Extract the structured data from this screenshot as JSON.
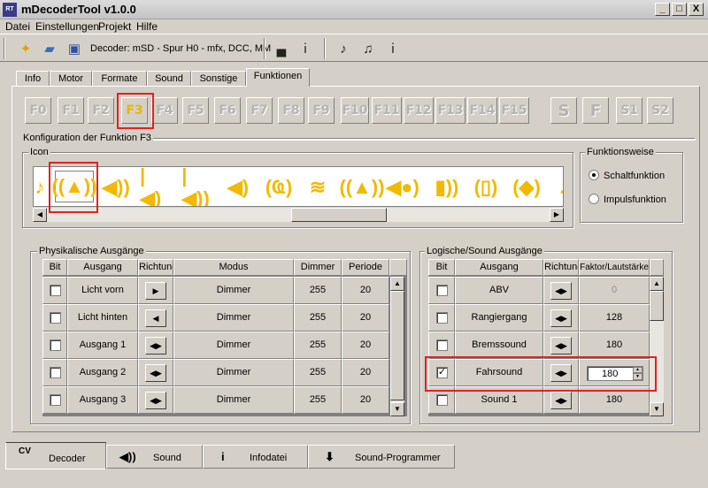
{
  "window": {
    "title": "mDecoderTool v1.0.0",
    "icon_label": "RT",
    "min": "_",
    "max": "□",
    "close": "X"
  },
  "menu": [
    "Datei",
    "Einstellungen",
    "Projekt",
    "Hilfe"
  ],
  "toolbar": {
    "decoder_info": "Decoder: mSD - Spur H0 - mfx, DCC, MM"
  },
  "tabs": [
    "Info",
    "Motor",
    "Formate",
    "Sound",
    "Sonstige",
    "Funktionen"
  ],
  "active_tab": "Funktionen",
  "function_buttons": [
    "F0",
    "F1",
    "F2",
    "F3",
    "F4",
    "F5",
    "F6",
    "F7",
    "F8",
    "F9",
    "F10",
    "F11",
    "F12",
    "F13",
    "F14",
    "F15"
  ],
  "special_buttons": [
    "S",
    "F",
    "S1",
    "S2"
  ],
  "selected_function": "F3",
  "config": {
    "title": "Konfiguration der Funktion F3",
    "icon_group": "Icon"
  },
  "funktionsweise": {
    "title": "Funktionsweise",
    "options": [
      "Schaltfunktion",
      "Impulsfunktion"
    ],
    "selected": "Schaltfunktion"
  },
  "icons": [
    "horn-icon",
    "bell-icon",
    "whistle-icon",
    "horn-left-icon",
    "horn-both-icon",
    "speaker-icon",
    "radio-tower-icon",
    "compressor-icon",
    "warning-bell-icon",
    "steam-icon",
    "announcement-icon",
    "phone-icon",
    "sound-both-icon",
    "horn-right-icon"
  ],
  "physical": {
    "title": "Physikalische Ausgänge",
    "headers": [
      "Bit",
      "Ausgang",
      "Richtung",
      "Modus",
      "Dimmer",
      "Periode"
    ],
    "rows": [
      {
        "checked": false,
        "name": "Licht vorn",
        "dir": "▶",
        "mode": "Dimmer",
        "dimmer": "255",
        "period": "20"
      },
      {
        "checked": false,
        "name": "Licht hinten",
        "dir": "◀",
        "mode": "Dimmer",
        "dimmer": "255",
        "period": "20"
      },
      {
        "checked": false,
        "name": "Ausgang 1",
        "dir": "◀▶",
        "mode": "Dimmer",
        "dimmer": "255",
        "period": "20"
      },
      {
        "checked": false,
        "name": "Ausgang 2",
        "dir": "◀▶",
        "mode": "Dimmer",
        "dimmer": "255",
        "period": "20"
      },
      {
        "checked": false,
        "name": "Ausgang 3",
        "dir": "◀▶",
        "mode": "Dimmer",
        "dimmer": "255",
        "period": "20"
      }
    ]
  },
  "logical": {
    "title": "Logische/Sound Ausgänge",
    "headers": [
      "Bit",
      "Ausgang",
      "Richtung",
      "Faktor/Lautstärke"
    ],
    "rows": [
      {
        "checked": false,
        "name": "ABV",
        "dir": "◀▶",
        "factor": "0"
      },
      {
        "checked": false,
        "name": "Rangiergang",
        "dir": "◀▶",
        "factor": "128"
      },
      {
        "checked": false,
        "name": "Bremssound",
        "dir": "◀▶",
        "factor": "180"
      },
      {
        "checked": true,
        "name": "Fahrsound",
        "dir": "◀▶",
        "factor": "180"
      },
      {
        "checked": false,
        "name": "Sound 1",
        "dir": "◀▶",
        "factor": "180"
      }
    ]
  },
  "bottom_tabs": [
    {
      "icon": "CV",
      "label": "Decoder"
    },
    {
      "icon": "◀))",
      "label": "Sound"
    },
    {
      "icon": "i",
      "label": "Infodatei"
    },
    {
      "icon": "⬇",
      "label": "Sound-Programmer"
    }
  ],
  "colors": {
    "accent_icon": "#f2b900",
    "highlight_box": "#e32020"
  }
}
